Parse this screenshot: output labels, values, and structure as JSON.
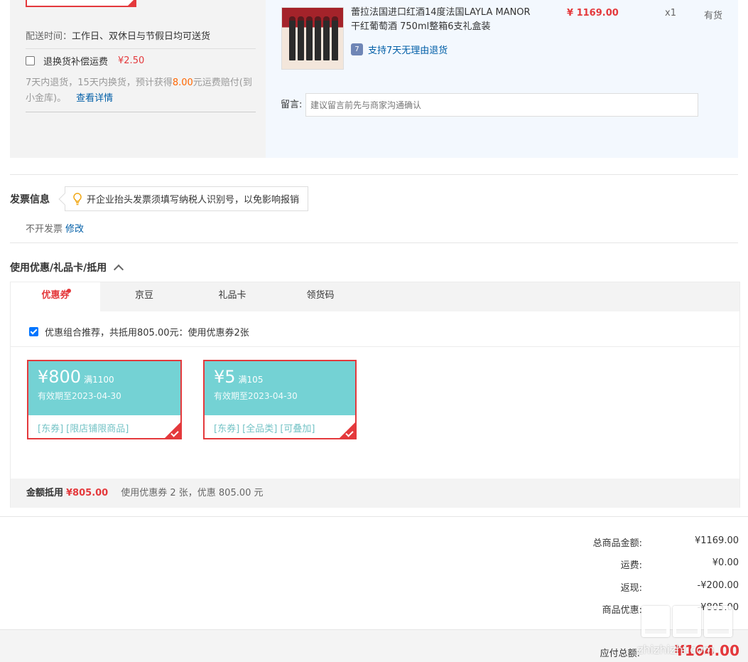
{
  "shipping": {
    "time_label": "配送时间：",
    "time_value": "工作日、双休日与节假日均可送货",
    "insurance_label": "退换货补偿运费",
    "insurance_price": "¥2.50",
    "insurance_desc_1": "7天内退货，15天内换货，预计获得",
    "insurance_amount": "8.00",
    "insurance_desc_2": "元运费赔付(到小金库)。",
    "details_link": "查看详情"
  },
  "product": {
    "title": "蕾拉法国进口红酒14度法国LAYLA MANOR干红葡萄酒 750ml整箱6支礼盒装",
    "price": "¥ 1169.00",
    "qty": "x1",
    "stock": "有货",
    "return_policy": "支持7天无理由退货",
    "return_icon_text": "7",
    "message_label": "留言:",
    "message_placeholder": "建议留言前先与商家沟通确认"
  },
  "invoice": {
    "title": "发票信息",
    "tip": "开企业抬头发票须填写纳税人识别号，以免影响报销",
    "value": "不开发票",
    "edit_link": "修改"
  },
  "coupons": {
    "title": "使用优惠/礼品卡/抵用",
    "tabs": [
      {
        "label": "优惠券"
      },
      {
        "label": "京豆"
      },
      {
        "label": "礼品卡"
      },
      {
        "label": "领货码"
      }
    ],
    "combo_text": "优惠组合推荐，共抵用805.00元：使用优惠券2张",
    "items": [
      {
        "amount": "¥800",
        "condition": "满1100",
        "expiry": "有效期至2023-04-30",
        "tags": [
          "[东券]",
          "[限店铺限商品]"
        ]
      },
      {
        "amount": "¥5",
        "condition": "满105",
        "expiry": "有效期至2023-04-30",
        "tags": [
          "[东券]",
          "[全品类]",
          "[可叠加]"
        ]
      }
    ],
    "footer_label": "金额抵用",
    "footer_amount": "¥805.00",
    "footer_desc": "使用优惠券 2 张，优惠 805.00 元"
  },
  "summary": {
    "rows": [
      {
        "label": "总商品金额:",
        "value": "¥1169.00"
      },
      {
        "label": "运费:",
        "value": "¥0.00"
      },
      {
        "label": "返现:",
        "value": "-¥200.00"
      },
      {
        "label": "商品优惠:",
        "value": "-¥805.00"
      }
    ],
    "total_label": "应付总额:",
    "total_value": "¥164.00"
  },
  "watermark": {
    "site": "zhizhizhi.com"
  },
  "colors": {
    "accent": "#e4393c",
    "link": "#005ea7",
    "coupon_bg": "#74d2d4"
  }
}
